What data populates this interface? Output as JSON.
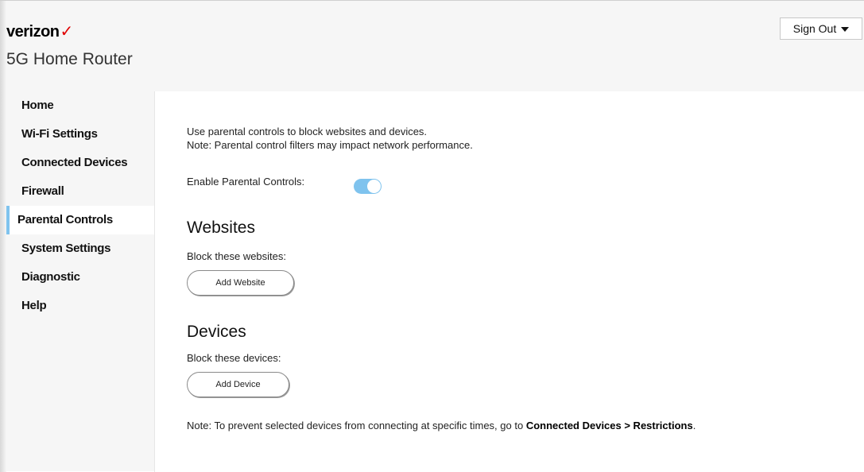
{
  "brand": {
    "logo_text": "verizon",
    "logo_mark": "✓",
    "product": "5G Home Router"
  },
  "header": {
    "signout_label": "Sign Out"
  },
  "sidebar": {
    "items": [
      {
        "label": "Home"
      },
      {
        "label": "Wi-Fi Settings"
      },
      {
        "label": "Connected Devices"
      },
      {
        "label": "Firewall"
      },
      {
        "label": "Parental Controls",
        "active": true
      },
      {
        "label": "System Settings"
      },
      {
        "label": "Diagnostic"
      },
      {
        "label": "Help"
      }
    ],
    "accent_color": "#7fc3ee"
  },
  "main": {
    "intro_line1": "Use parental controls to block websites and devices.",
    "intro_line2": "Note: Parental control filters may impact network performance.",
    "enable_label": "Enable Parental Controls:",
    "enable_state": true,
    "websites": {
      "title": "Websites",
      "subtitle": "Block these websites:",
      "button_label": "Add Website"
    },
    "devices": {
      "title": "Devices",
      "subtitle": "Block these devices:",
      "button_label": "Add Device"
    },
    "bottom_note_prefix": "Note: To prevent selected devices from connecting at specific times, go to ",
    "bottom_note_link": "Connected Devices > Restrictions",
    "bottom_note_suffix": "."
  },
  "icons": {
    "signout_caret": "chevron-down-icon",
    "toggle": "toggle-switch"
  }
}
